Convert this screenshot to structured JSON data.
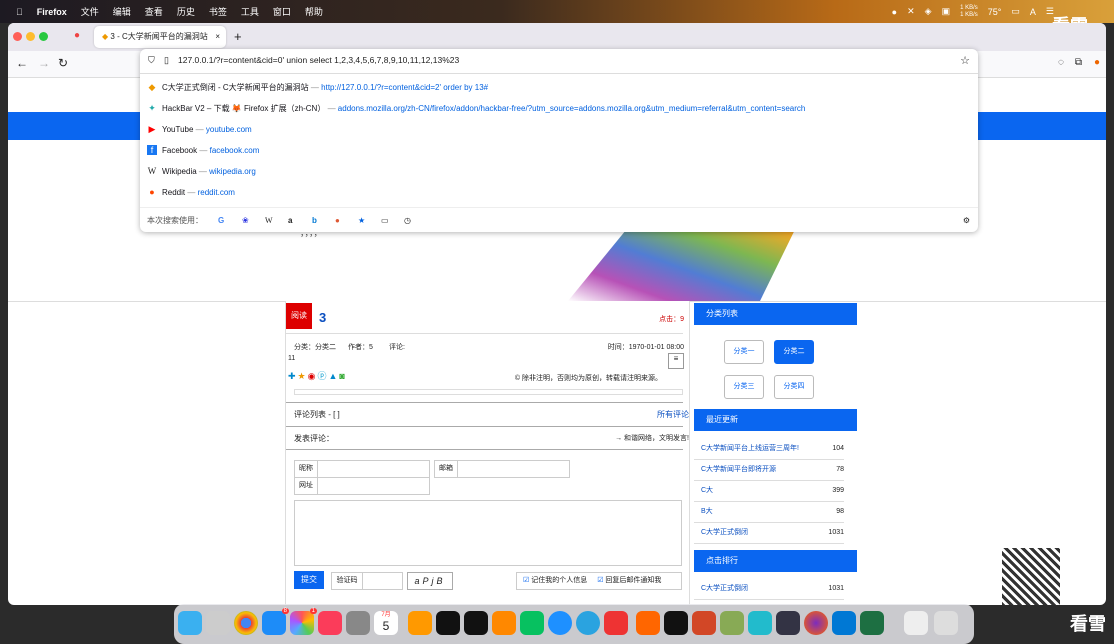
{
  "menubar": {
    "app": "Firefox",
    "items": [
      "文件",
      "编辑",
      "查看",
      "历史",
      "书签",
      "工具",
      "窗口",
      "帮助"
    ],
    "speed": "1 KB/s\n1 KB/s",
    "temp": "75°"
  },
  "tab": {
    "title": "3 - C大学新闻平台的漏洞站"
  },
  "urlbar": {
    "value": "127.0.0.1/?r=content&cid=0' union select 1,2,3,4,5,6,7,8,9,10,11,12,13%23"
  },
  "suggestions": [
    {
      "icon": "site-icon",
      "title": "C大学正式倒闭 - C大学新闻平台的漏洞站",
      "sep": "—",
      "url": "http://127.0.0.1/?r=content&cid=2' order by 13#"
    },
    {
      "icon": "hackbar-icon",
      "title": "HackBar V2 – 下载 🦊 Firefox 扩展（zh-CN）",
      "sep": "—",
      "url": "addons.mozilla.org/zh-CN/firefox/addon/hackbar-free/?utm_source=addons.mozilla.org&utm_medium=referral&utm_content=search"
    },
    {
      "icon": "youtube-icon",
      "title": "YouTube",
      "sep": "—",
      "url": "youtube.com"
    },
    {
      "icon": "facebook-icon",
      "title": "Facebook",
      "sep": "—",
      "url": "facebook.com"
    },
    {
      "icon": "wikipedia-icon",
      "title": "Wikipedia",
      "sep": "—",
      "url": "wikipedia.org"
    },
    {
      "icon": "reddit-icon",
      "title": "Reddit",
      "sep": "—",
      "url": "reddit.com"
    }
  ],
  "search_label": "本次搜索使用：",
  "article": {
    "badge": "阅读",
    "title": "3",
    "clicks": "点击：9",
    "category": "分类：分类二",
    "author": "作者：5",
    "comment": "评论:",
    "time": "时间：1970-01-01 08:00",
    "eleven": "11",
    "copyright": "© 除非注明，否则均为原创，转载请注明来源。",
    "comment_list": "评论列表 - [ ]",
    "all_comments": "所有评论",
    "post_comment": "发表评论：",
    "post_hint": "→ 和谐网络，文明发言!",
    "nick_label": "昵称",
    "email_label": "邮箱",
    "site_label": "网址",
    "submit": "提交",
    "captcha_label": "验证码",
    "captcha_img": "aPjB",
    "remember": "记住我的个人信息",
    "notify": "回复后邮件通知我"
  },
  "sidebar": {
    "cat_title": "分类列表",
    "cats": [
      "分类一",
      "分类二",
      "分类三",
      "分类四"
    ],
    "recent_title": "最近更新",
    "recent": [
      {
        "t": "C大学新闻平台上线运营三周年!",
        "n": "104"
      },
      {
        "t": "C大学新闻平台即将开源",
        "n": "78"
      },
      {
        "t": "C大",
        "n": "399"
      },
      {
        "t": "B大",
        "n": "98"
      },
      {
        "t": "C大学正式倒闭",
        "n": "1031"
      }
    ],
    "hot_title": "点击排行",
    "hot": [
      {
        "t": "C大学正式倒闭",
        "n": "1031"
      }
    ]
  },
  "dock": {
    "calendar_month": "7月",
    "calendar_day": "5",
    "badge1": "8",
    "badge2": "1"
  },
  "watermark": "看雪"
}
